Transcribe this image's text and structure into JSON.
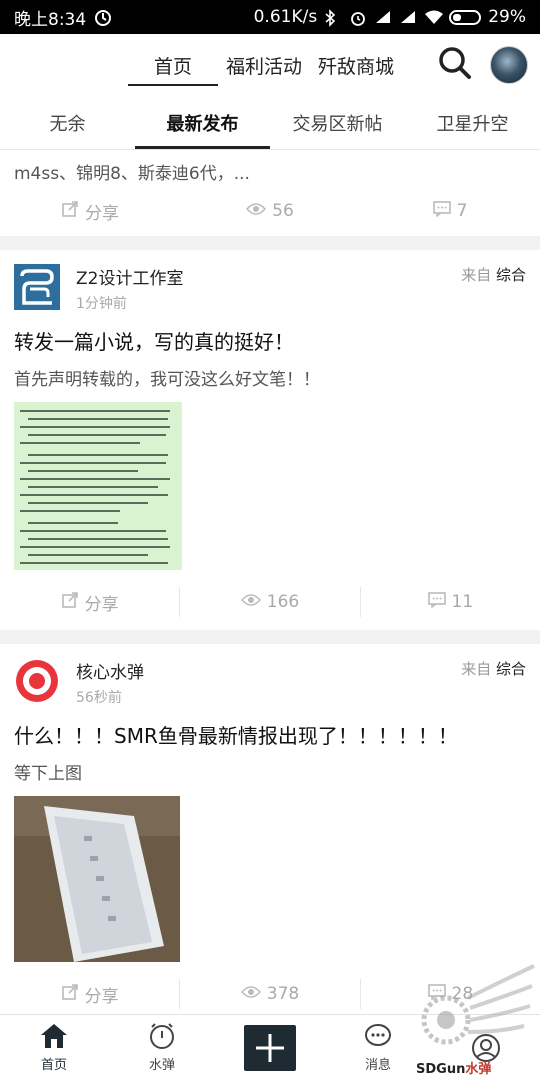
{
  "status_bar": {
    "time": "晚上8:34",
    "speed": "0.61K/s",
    "battery": "29%"
  },
  "top_nav": {
    "tabs": [
      {
        "label": "首页",
        "active": true
      },
      {
        "label": "福利活动",
        "active": false
      },
      {
        "label": "歼敌商城",
        "active": false
      }
    ]
  },
  "category_tabs": [
    {
      "label": "无余",
      "active": false
    },
    {
      "label": "最新发布",
      "active": true
    },
    {
      "label": "交易区新帖",
      "active": false
    },
    {
      "label": "卫星升空",
      "active": false
    }
  ],
  "feed": {
    "partial_card": {
      "snippet": "m4ss、锦明8、斯泰迪6代，...",
      "share_label": "分享",
      "views": "56",
      "comments": "7"
    },
    "posts": [
      {
        "author": "Z2设计工作室",
        "time": "1分钟前",
        "source_prefix": "来自",
        "source": "综合",
        "title": "转发一篇小说，写的真的挺好！",
        "subtitle": "首先声明转载的，我可没这么好文笔！！",
        "share_label": "分享",
        "views": "166",
        "comments": "11"
      },
      {
        "author": "核心水弹",
        "time": "56秒前",
        "source_prefix": "来自",
        "source": "综合",
        "title": "什么！！！SMR鱼骨最新情报出现了！！！！！！",
        "subtitle": "等下上图",
        "share_label": "分享",
        "views": "378",
        "comments": "28"
      }
    ]
  },
  "bottom_nav": [
    {
      "label": "首页",
      "icon": "home-icon",
      "active": true
    },
    {
      "label": "水弹",
      "icon": "timer-icon",
      "active": false
    },
    {
      "label": "",
      "icon": "plus-icon",
      "active": false
    },
    {
      "label": "消息",
      "icon": "message-icon",
      "active": false
    },
    {
      "label": "",
      "icon": "profile-icon",
      "active": false
    }
  ],
  "watermark": {
    "brand": "SDGun",
    "brand_suffix": "水弹"
  },
  "colors": {
    "accent": "#222222",
    "header_bg": "#000000",
    "logo_red": "#e8353b",
    "z2_blue": "#2e6e9e"
  }
}
